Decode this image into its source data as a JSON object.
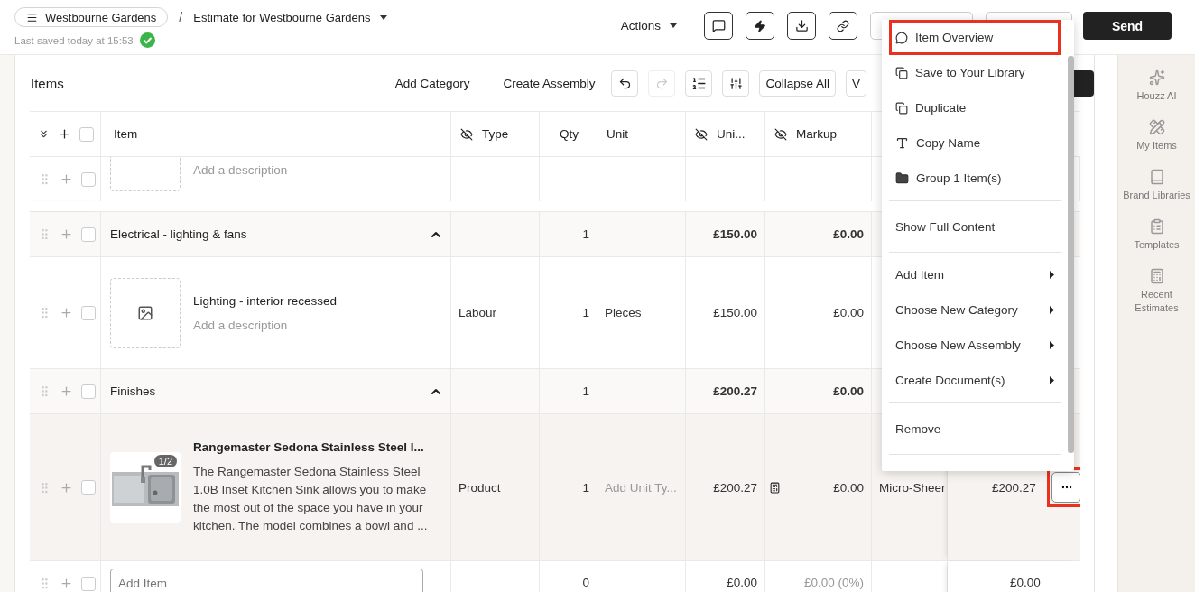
{
  "header": {
    "project": "Westbourne Gardens",
    "separator": "/",
    "document": "Estimate for Westbourne Gardens",
    "saved": "Last saved today at 15:53",
    "actions": "Actions",
    "send": "Send"
  },
  "toolbar": {
    "title": "Items",
    "buttons": [
      {
        "kind": "text",
        "label": "Add Category",
        "disabled": false
      },
      {
        "kind": "text",
        "label": "Create Assembly",
        "disabled": false
      },
      {
        "kind": "icon",
        "disabled": false
      },
      {
        "kind": "icon",
        "disabled": true
      },
      {
        "kind": "icon",
        "disabled": false
      },
      {
        "kind": "icon",
        "disabled": false
      },
      {
        "kind": "outlined",
        "label": "Collapse All",
        "disabled": false
      },
      {
        "kind": "outlined",
        "label": "V",
        "disabled": false
      }
    ]
  },
  "select_all": {
    "checked": false
  },
  "columns": [
    {
      "label": "Item",
      "hidden": false
    },
    {
      "label": "Type",
      "hidden": true
    },
    {
      "label": "Qty",
      "hidden": false
    },
    {
      "label": "Unit",
      "hidden": false
    },
    {
      "label": "Uni...",
      "hidden": true
    },
    {
      "label": "Markup",
      "hidden": true
    }
  ],
  "rows": [
    {
      "kind": "partial",
      "checked": false,
      "description": "Add a description"
    },
    {
      "kind": "category",
      "checked": false,
      "name": "Electrical - lighting & fans",
      "expanded": true,
      "qty": "1",
      "unit_price": "£150.00",
      "markup": "£0.00"
    },
    {
      "kind": "item",
      "checked": false,
      "name": "Lighting - interior recessed",
      "description": "Add a description",
      "type": "Labour",
      "qty": "1",
      "unit": "Pieces",
      "unit_price": "£150.00",
      "markup": "£0.00"
    },
    {
      "kind": "category",
      "checked": false,
      "name": "Finishes",
      "expanded": true,
      "qty": "1",
      "unit_price": "£200.27",
      "markup": "£0.00"
    },
    {
      "kind": "product",
      "checked": false,
      "selected": true,
      "name": "Rangemaster Sedona Stainless Steel I...",
      "description": "The Rangemaster Sedona Stainless Steel 1.0B Inset Kitchen Sink allows you to make the most out of the space you have in your kitchen. The model combines a bowl and ...",
      "image_badge": "1/2",
      "type": "Product",
      "qty": "1",
      "unit_placeholder": "Add Unit Ty...",
      "unit_price": "£200.27",
      "markup": "£0.00",
      "column_8": "Micro-Sheer",
      "total": "£200.27",
      "more_highlighted": true
    },
    {
      "kind": "add",
      "checked": false,
      "placeholder": "Add Item",
      "qty": "0",
      "unit_price": "£0.00",
      "markup": "£0.00 (0%)",
      "total": "£0.00"
    }
  ],
  "menu": {
    "sections": [
      [
        {
          "kind": "icon",
          "label": "Item Overview",
          "highlighted": true
        },
        {
          "kind": "icon",
          "label": "Save to Your Library",
          "highlighted": false
        },
        {
          "kind": "icon",
          "label": "Duplicate",
          "highlighted": false
        },
        {
          "kind": "icon",
          "label": "Copy Name",
          "highlighted": false
        },
        {
          "kind": "icon",
          "label": "Group 1 Item(s)",
          "highlighted": false
        }
      ],
      [
        {
          "kind": "plain",
          "label": "Show Full Content",
          "highlighted": false
        }
      ],
      [
        {
          "kind": "submenu",
          "label": "Add Item",
          "highlighted": false
        },
        {
          "kind": "submenu",
          "label": "Choose New Category",
          "highlighted": false
        },
        {
          "kind": "submenu",
          "label": "Choose New Assembly",
          "highlighted": false
        },
        {
          "kind": "submenu",
          "label": "Create Document(s)",
          "highlighted": false
        }
      ],
      [
        {
          "kind": "plain",
          "label": "Remove",
          "highlighted": false
        }
      ]
    ]
  },
  "sidebar": {
    "items": [
      {
        "label": "Houzz AI"
      },
      {
        "label": "My Items"
      },
      {
        "label": "Brand Libraries"
      },
      {
        "label": "Templates"
      },
      {
        "label": "Recent Estimates"
      }
    ]
  }
}
